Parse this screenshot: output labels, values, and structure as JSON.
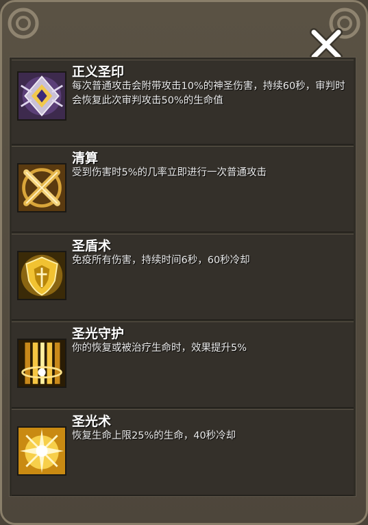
{
  "close_label": "×",
  "skills": [
    {
      "name": "正义圣印",
      "desc": "每次普通攻击会附带攻击10%的神圣伤害，持续60秒，审判时会恢复此次审判攻击50%的生命值",
      "icon": "holy-seal-icon"
    },
    {
      "name": "清算",
      "desc": "受到伤害时5%的几率立即进行一次普通攻击",
      "icon": "crossed-swords-icon"
    },
    {
      "name": "圣盾术",
      "desc": "免疫所有伤害，持续时间6秒，60秒冷却",
      "icon": "golden-shield-icon"
    },
    {
      "name": "圣光守护",
      "desc": "你的恢复或被治疗生命时，效果提升5%",
      "icon": "light-pillars-icon"
    },
    {
      "name": "圣光术",
      "desc": "恢复生命上限25%的生命，40秒冷却",
      "icon": "holy-light-burst-icon"
    }
  ]
}
